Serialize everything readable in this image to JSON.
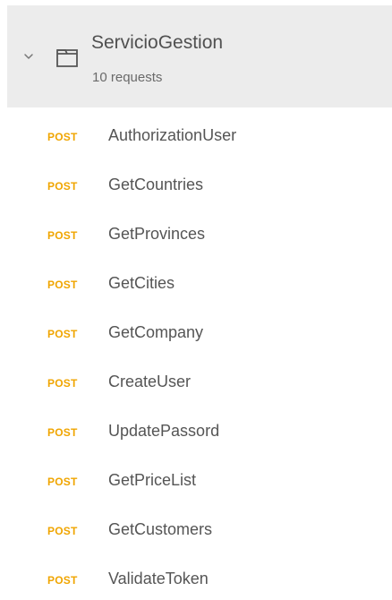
{
  "collection": {
    "name": "ServicioGestion",
    "count_label": "10 requests",
    "chevron_icon": "chevron-down-icon",
    "folder_icon": "folder-icon"
  },
  "requests": [
    {
      "method": "POST",
      "name": "AuthorizationUser"
    },
    {
      "method": "POST",
      "name": "GetCountries"
    },
    {
      "method": "POST",
      "name": "GetProvinces"
    },
    {
      "method": "POST",
      "name": "GetCities"
    },
    {
      "method": "POST",
      "name": "GetCompany"
    },
    {
      "method": "POST",
      "name": "CreateUser"
    },
    {
      "method": "POST",
      "name": "UpdatePassord"
    },
    {
      "method": "POST",
      "name": "GetPriceList"
    },
    {
      "method": "POST",
      "name": "GetCustomers"
    },
    {
      "method": "POST",
      "name": "ValidateToken"
    }
  ],
  "colors": {
    "method_post": "#f0a500",
    "header_background": "#ececec",
    "text": "#555555"
  }
}
